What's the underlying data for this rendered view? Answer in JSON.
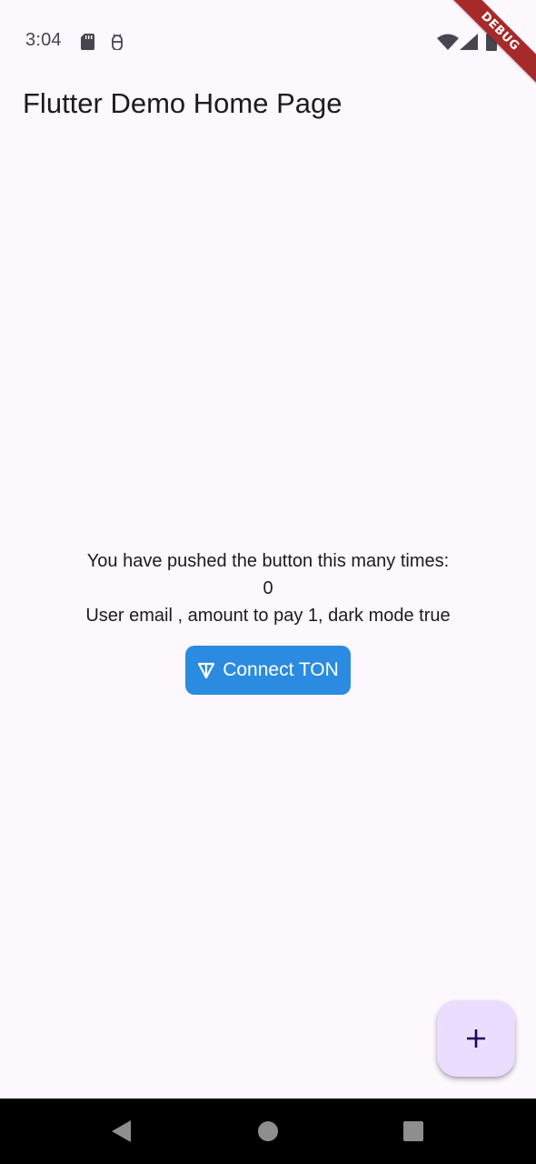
{
  "status_bar": {
    "time": "3:04",
    "icons": [
      "sd-card-icon",
      "android-debug-icon",
      "wifi-icon",
      "signal-icon",
      "battery-icon"
    ]
  },
  "debug_banner": {
    "label": "DEBUG",
    "color": "#a72a2a"
  },
  "app_bar": {
    "title": "Flutter Demo Home Page"
  },
  "body": {
    "counter_label": "You have pushed the button this many times:",
    "counter_value": "0",
    "info_line": "User email , amount to pay 1, dark mode true"
  },
  "connect_button": {
    "label": "Connect TON",
    "icon": "ton-icon",
    "color": "#2a8be0"
  },
  "fab": {
    "icon": "plus-icon",
    "background": "#eaddff"
  },
  "nav_bar": {
    "icons": [
      "back-icon",
      "home-icon",
      "recents-icon"
    ]
  },
  "theme": {
    "background": "#fdf7fe",
    "text": "#1c1b1f"
  }
}
